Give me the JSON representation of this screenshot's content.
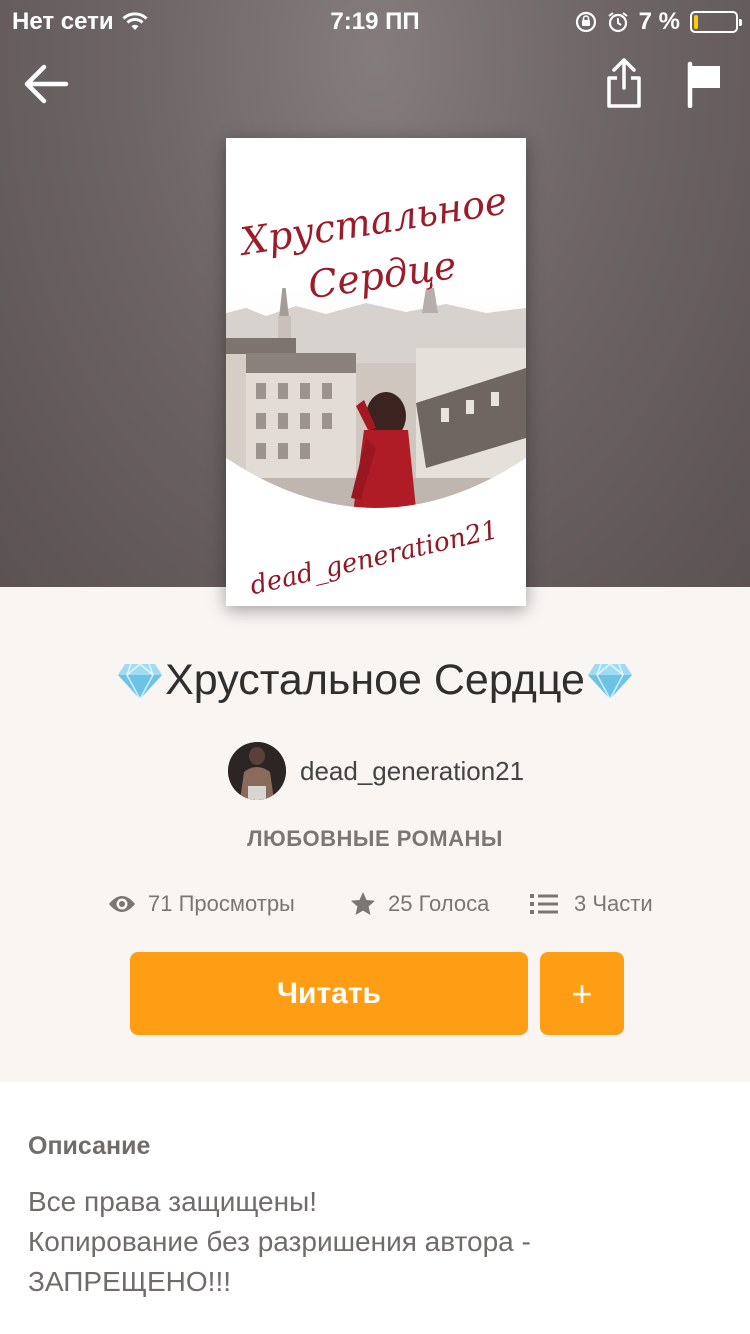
{
  "status_bar": {
    "carrier": "Нет сети",
    "time": "7:19 ПП",
    "battery_text": "7 %",
    "battery_level": 0.07,
    "battery_color": "#ffcc00"
  },
  "nav": {
    "back_icon": "arrow-left-icon",
    "share_icon": "share-icon",
    "report_icon": "flag-icon"
  },
  "cover": {
    "title_line1": "Хрустальное",
    "title_line2": "Сердце",
    "author": "dead_generation21",
    "title_color": "#9b1b2a"
  },
  "book": {
    "title": "Хрустальное Сердце",
    "title_icon": "gem-icon",
    "author": "dead_generation21",
    "genre": "ЛЮБОВНЫЕ РОМАНЫ"
  },
  "stats": {
    "views": "71 Просмотры",
    "votes": "25 Голоса",
    "parts": "3 Части"
  },
  "actions": {
    "read_label": "Читать",
    "add_label": "+",
    "accent_color": "#ff9e14"
  },
  "description": {
    "heading": "Описание",
    "line1": "Все права защищены!",
    "line2": "Копирование без разришения автора -",
    "line3": "ЗАПРЕЩЕНО!!!"
  }
}
